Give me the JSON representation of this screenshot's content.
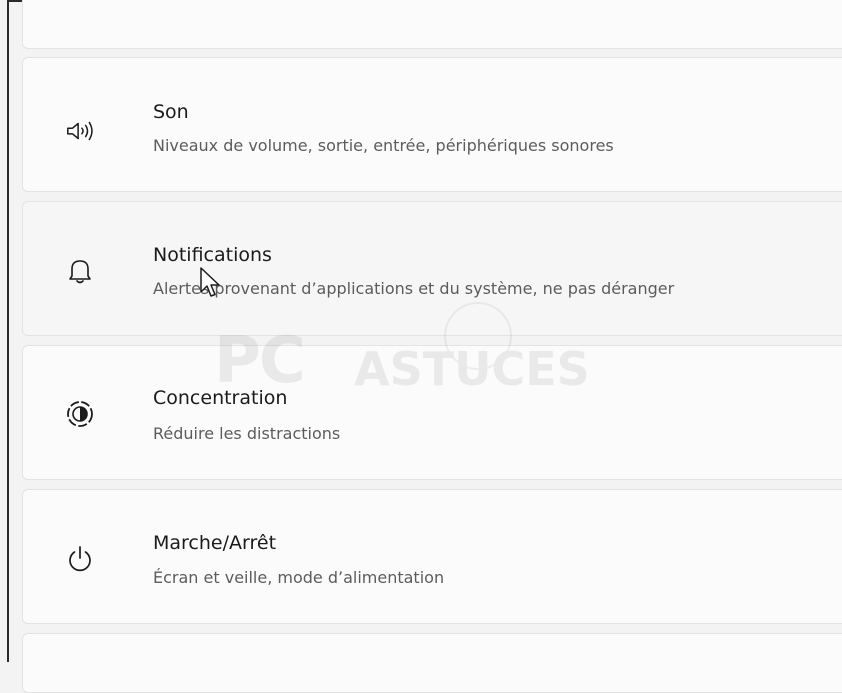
{
  "settings_list": {
    "items": [
      {
        "id": "son",
        "title": "Son",
        "description": "Niveaux de volume, sortie, entrée, périphériques sonores",
        "icon": "speaker-icon"
      },
      {
        "id": "notifications",
        "title": "Notifications",
        "description": "Alertes provenant d’applications et du système, ne pas déranger",
        "icon": "bell-icon"
      },
      {
        "id": "concentration",
        "title": "Concentration",
        "description": "Réduire les distractions",
        "icon": "focus-icon"
      },
      {
        "id": "marche",
        "title": "Marche/Arrêt",
        "description": "Écran et veille, mode d’alimentation",
        "icon": "power-icon"
      }
    ]
  },
  "watermark": {
    "brand": "PC",
    "word": "ASTUCES"
  },
  "colors": {
    "background": "#f3f3f3",
    "card": "#fbfbfb",
    "card_hover": "#f6f6f6",
    "title": "#1b1b1b",
    "description": "#5c5c5c"
  }
}
